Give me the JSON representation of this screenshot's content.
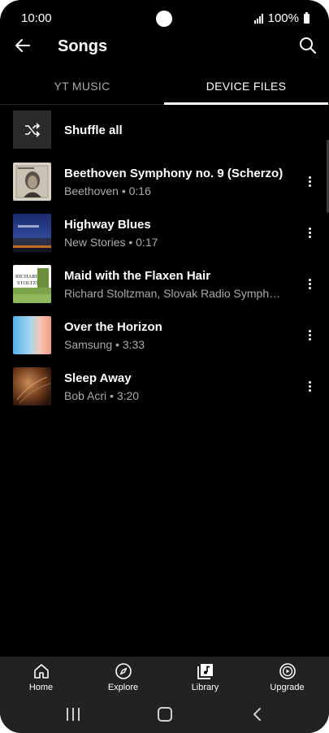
{
  "status_bar": {
    "time": "10:00",
    "battery": "100%"
  },
  "app_bar": {
    "title": "Songs"
  },
  "tabs": [
    {
      "label": "YT MUSIC"
    },
    {
      "label": "DEVICE FILES"
    }
  ],
  "shuffle": {
    "label": "Shuffle all"
  },
  "songs": [
    {
      "title": "Beethoven Symphony no. 9 (Scherzo)",
      "subtitle": "Beethoven • 0:16"
    },
    {
      "title": "Highway Blues",
      "subtitle": "New Stories • 0:17"
    },
    {
      "title": "Maid with the Flaxen Hair",
      "subtitle": "Richard Stoltzman, Slovak Radio Symph…"
    },
    {
      "title": "Over the Horizon",
      "subtitle": "Samsung • 3:33"
    },
    {
      "title": "Sleep Away",
      "subtitle": "Bob Acri • 3:20"
    }
  ],
  "album_art": {
    "maid": {
      "line1": "RICHARD",
      "line2": "STOLTZMAN"
    }
  },
  "bottom_nav": [
    {
      "label": "Home",
      "icon": "home-icon"
    },
    {
      "label": "Explore",
      "icon": "compass-icon"
    },
    {
      "label": "Library",
      "icon": "library-icon"
    },
    {
      "label": "Upgrade",
      "icon": "play-circle-icon"
    }
  ],
  "colors": {
    "background": "#000000",
    "secondary_text": "#aaaaaa",
    "nav_background": "#222222"
  }
}
